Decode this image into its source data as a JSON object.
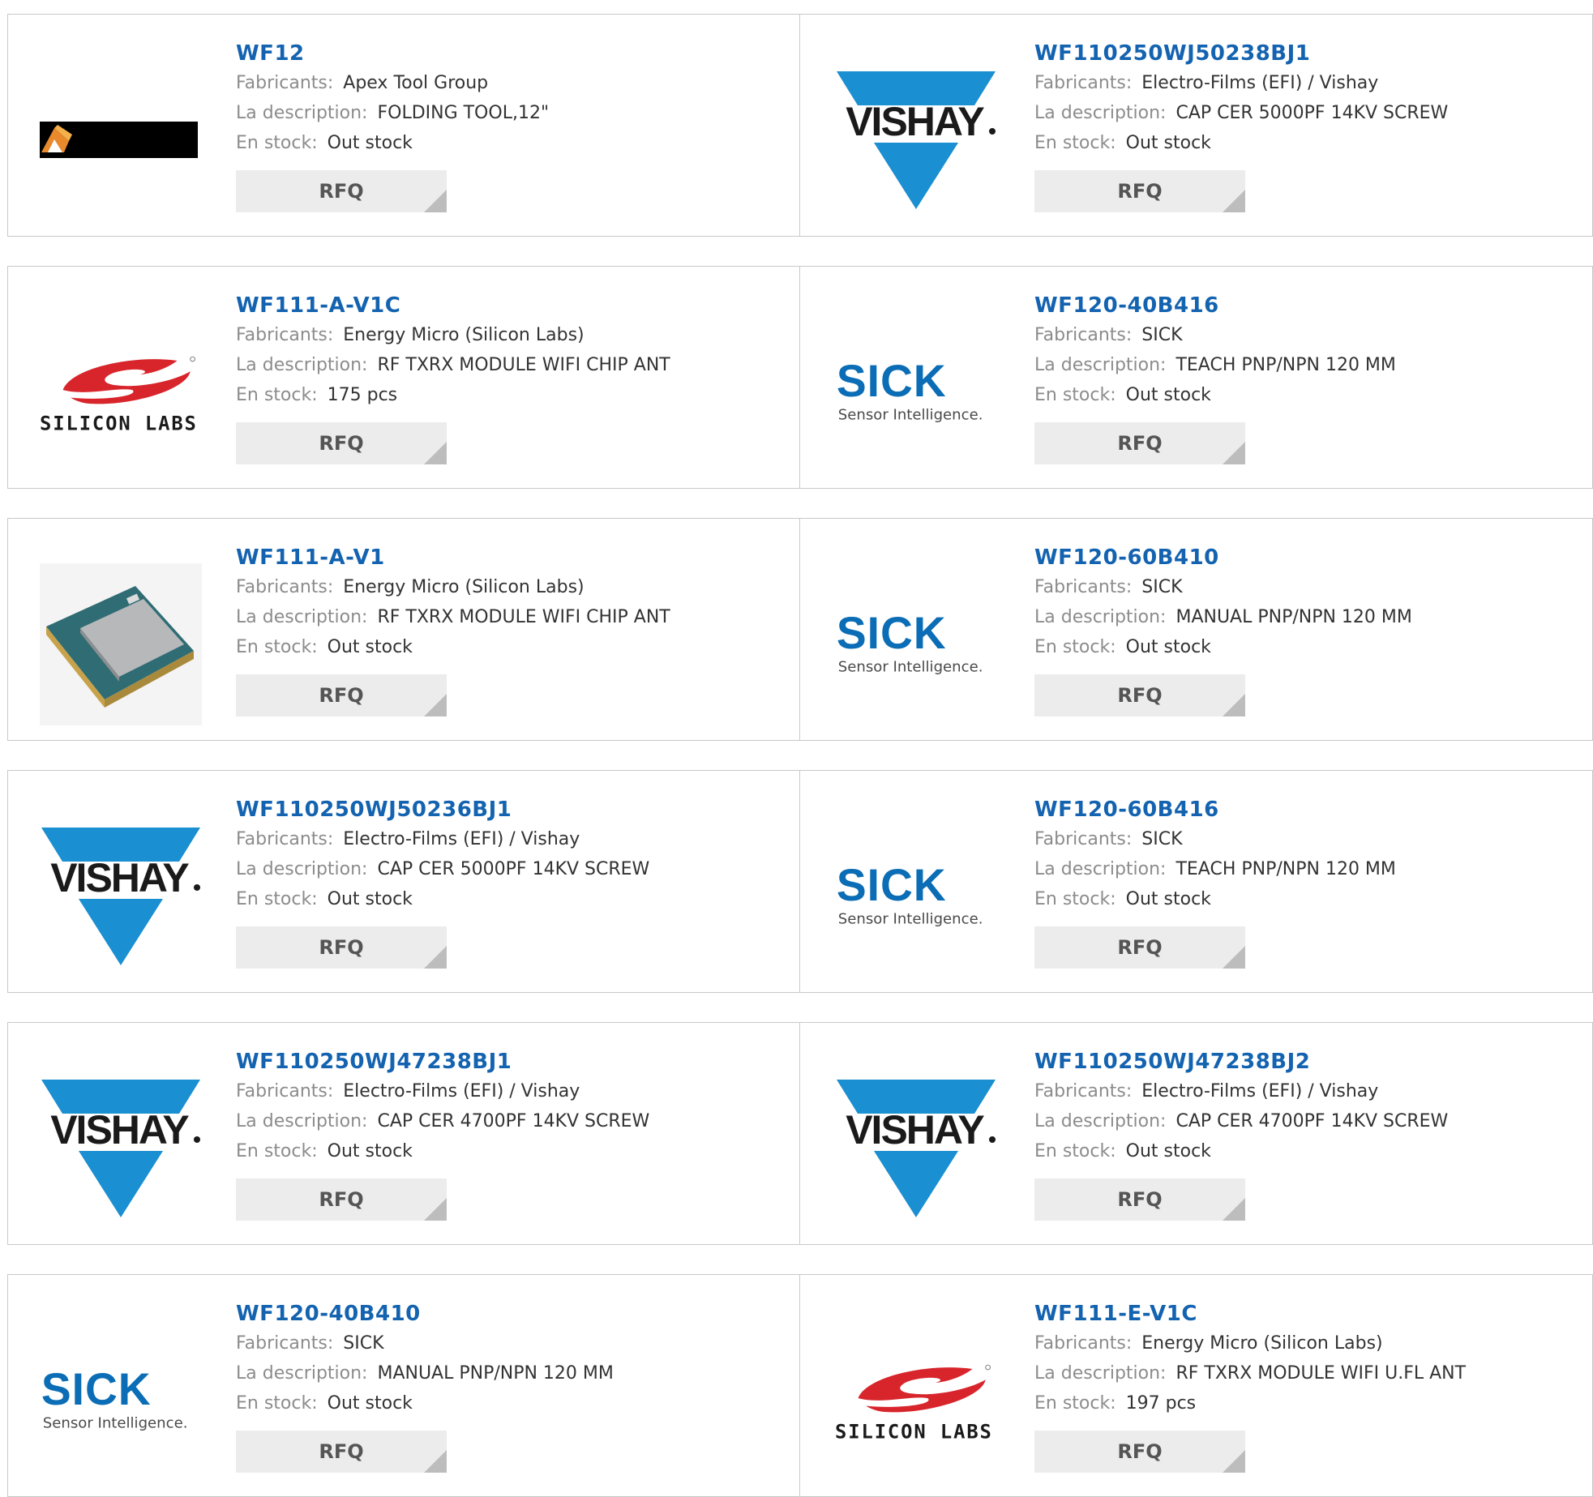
{
  "labels": {
    "manufacturer": "Fabricants:",
    "description": "La description:",
    "stock": "En stock:",
    "rfq": "RFQ"
  },
  "colors": {
    "part_link": "#1463b0",
    "vishay_blue": "#1a8fd1",
    "sick_blue": "#0a6db5",
    "silicon_red": "#d8252c"
  },
  "rows": [
    [
      {
        "part": "WF12",
        "manufacturer": "Apex Tool Group",
        "description": "FOLDING TOOL,12\"",
        "stock": "Out stock",
        "logo": "apex-logo"
      },
      {
        "part": "WF110250WJ50238BJ1",
        "manufacturer": "Electro-Films (EFI) / Vishay",
        "description": "CAP CER 5000PF 14KV SCREW",
        "stock": "Out stock",
        "logo": "vishay-logo"
      }
    ],
    [
      {
        "part": "WF111-A-V1C",
        "manufacturer": "Energy Micro (Silicon Labs)",
        "description": "RF TXRX MODULE WIFI CHIP ANT",
        "stock": "175 pcs",
        "logo": "silicon-labs-logo"
      },
      {
        "part": "WF120-40B416",
        "manufacturer": "SICK",
        "description": "TEACH PNP/NPN 120 MM",
        "stock": "Out stock",
        "logo": "sick-logo"
      }
    ],
    [
      {
        "part": "WF111-A-V1",
        "manufacturer": "Energy Micro (Silicon Labs)",
        "description": "RF TXRX MODULE WIFI CHIP ANT",
        "stock": "Out stock",
        "logo": "module-photo"
      },
      {
        "part": "WF120-60B410",
        "manufacturer": "SICK",
        "description": "MANUAL PNP/NPN 120 MM",
        "stock": "Out stock",
        "logo": "sick-logo"
      }
    ],
    [
      {
        "part": "WF110250WJ50236BJ1",
        "manufacturer": "Electro-Films (EFI) / Vishay",
        "description": "CAP CER 5000PF 14KV SCREW",
        "stock": "Out stock",
        "logo": "vishay-logo"
      },
      {
        "part": "WF120-60B416",
        "manufacturer": "SICK",
        "description": "TEACH PNP/NPN 120 MM",
        "stock": "Out stock",
        "logo": "sick-logo"
      }
    ],
    [
      {
        "part": "WF110250WJ47238BJ1",
        "manufacturer": "Electro-Films (EFI) / Vishay",
        "description": "CAP CER 4700PF 14KV SCREW",
        "stock": "Out stock",
        "logo": "vishay-logo"
      },
      {
        "part": "WF110250WJ47238BJ2",
        "manufacturer": "Electro-Films (EFI) / Vishay",
        "description": "CAP CER 4700PF 14KV SCREW",
        "stock": "Out stock",
        "logo": "vishay-logo"
      }
    ],
    [
      {
        "part": "WF120-40B410",
        "manufacturer": "SICK",
        "description": "MANUAL PNP/NPN 120 MM",
        "stock": "Out stock",
        "logo": "sick-logo"
      },
      {
        "part": "WF111-E-V1C",
        "manufacturer": "Energy Micro (Silicon Labs)",
        "description": "RF TXRX MODULE WIFI U.FL ANT",
        "stock": "197 pcs",
        "logo": "silicon-labs-logo"
      }
    ]
  ],
  "logo_text": {
    "vishay": "VISHAY",
    "sick": "SICK",
    "sick_tagline": "Sensor Intelligence.",
    "silicon_labs": "SILICON LABS"
  }
}
